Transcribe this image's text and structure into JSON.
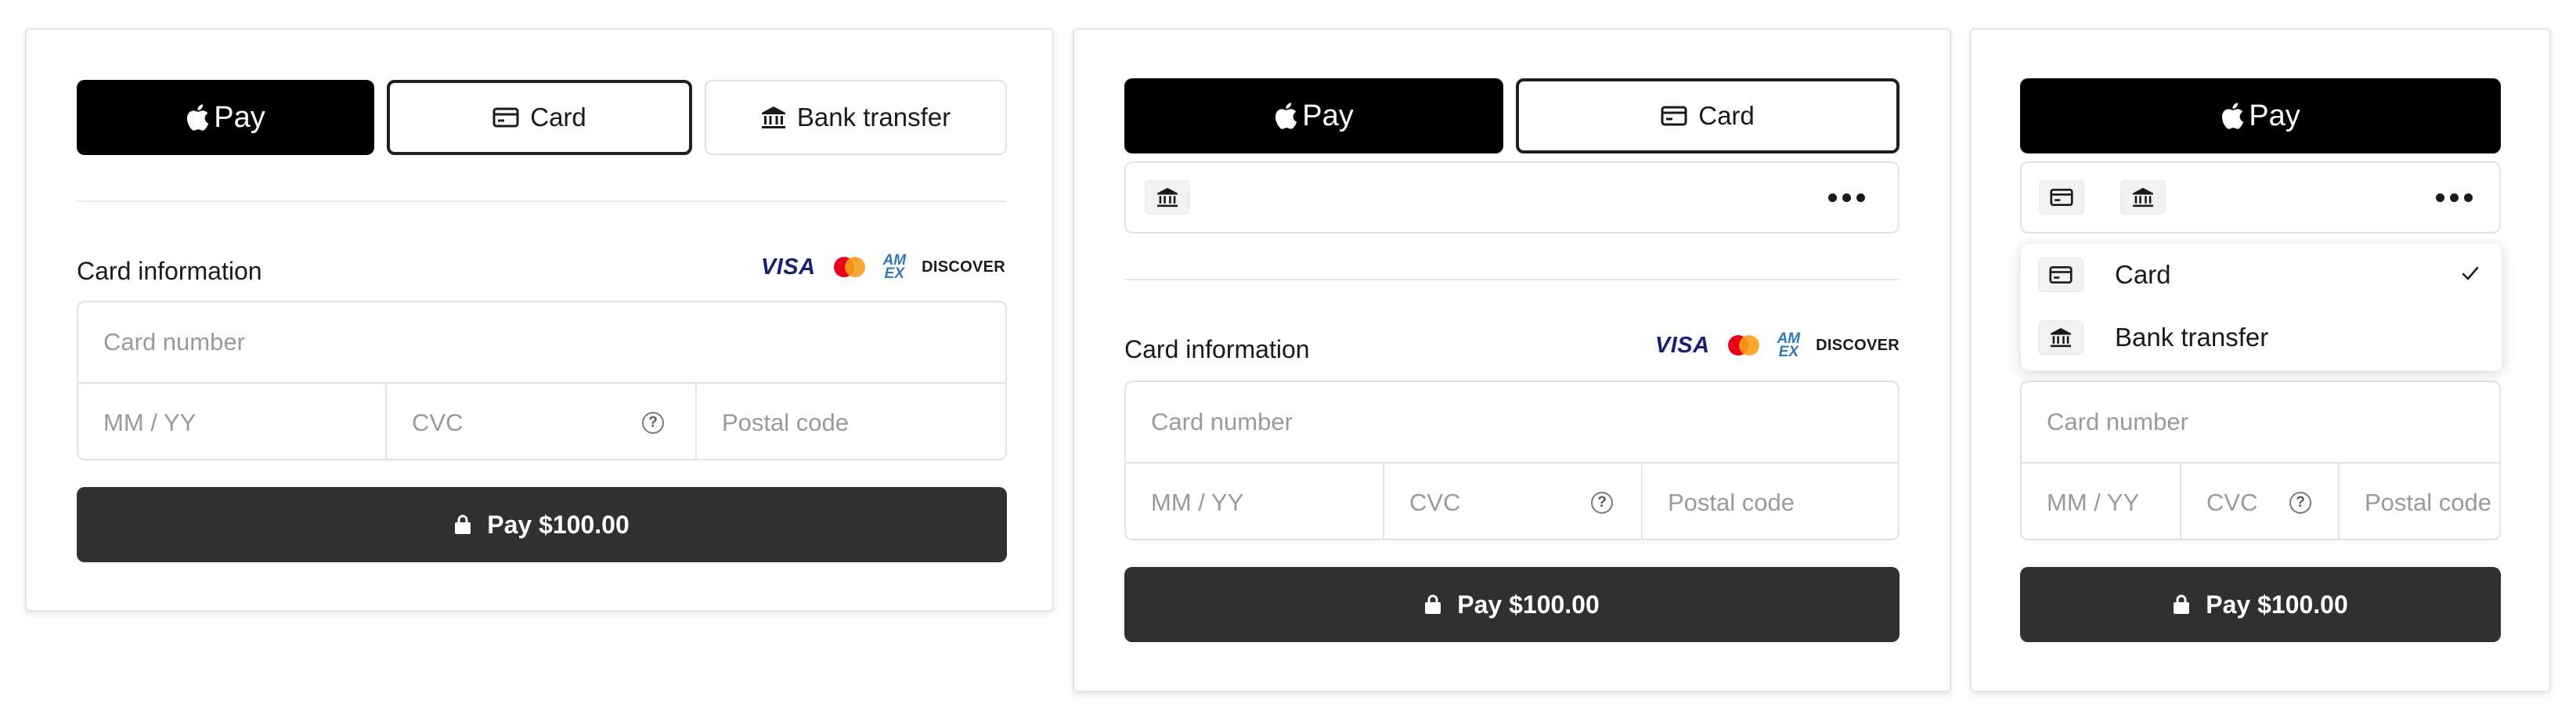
{
  "wallet": {
    "apple_pay_label": "Pay"
  },
  "methods": {
    "card_label": "Card",
    "bank_label": "Bank transfer"
  },
  "card_info": {
    "heading": "Card information",
    "brands": {
      "visa": "VISA",
      "amex_top": "AM",
      "amex_bottom": "EX",
      "discover": "DISCOVER"
    },
    "card_number_placeholder": "Card number",
    "expiry_placeholder": "MM / YY",
    "cvc_placeholder": "CVC",
    "cvc_help": "?",
    "postal_placeholder": "Postal code"
  },
  "pay_button": {
    "label": "Pay $100.00"
  },
  "dropdown": {
    "items": [
      {
        "label": "Card",
        "selected": true
      },
      {
        "label": "Bank transfer",
        "selected": false
      }
    ]
  },
  "icons": {
    "apple": "apple-logo-icon",
    "card": "credit-card-icon",
    "bank": "bank-icon",
    "more": "more-horizontal-icon",
    "lock": "lock-icon",
    "help": "help-circle-icon",
    "check": "checkmark-icon"
  },
  "colors": {
    "apple_pay_bg": "#000000",
    "pay_button_bg": "#303030",
    "border": "#e2e2e2",
    "placeholder": "#9a9a9a",
    "visa": "#1a1f71",
    "amex": "#2e77bb",
    "mastercard_red": "#eb001b",
    "mastercard_orange": "#f79e1b",
    "discover_orange": "#e6772e"
  }
}
